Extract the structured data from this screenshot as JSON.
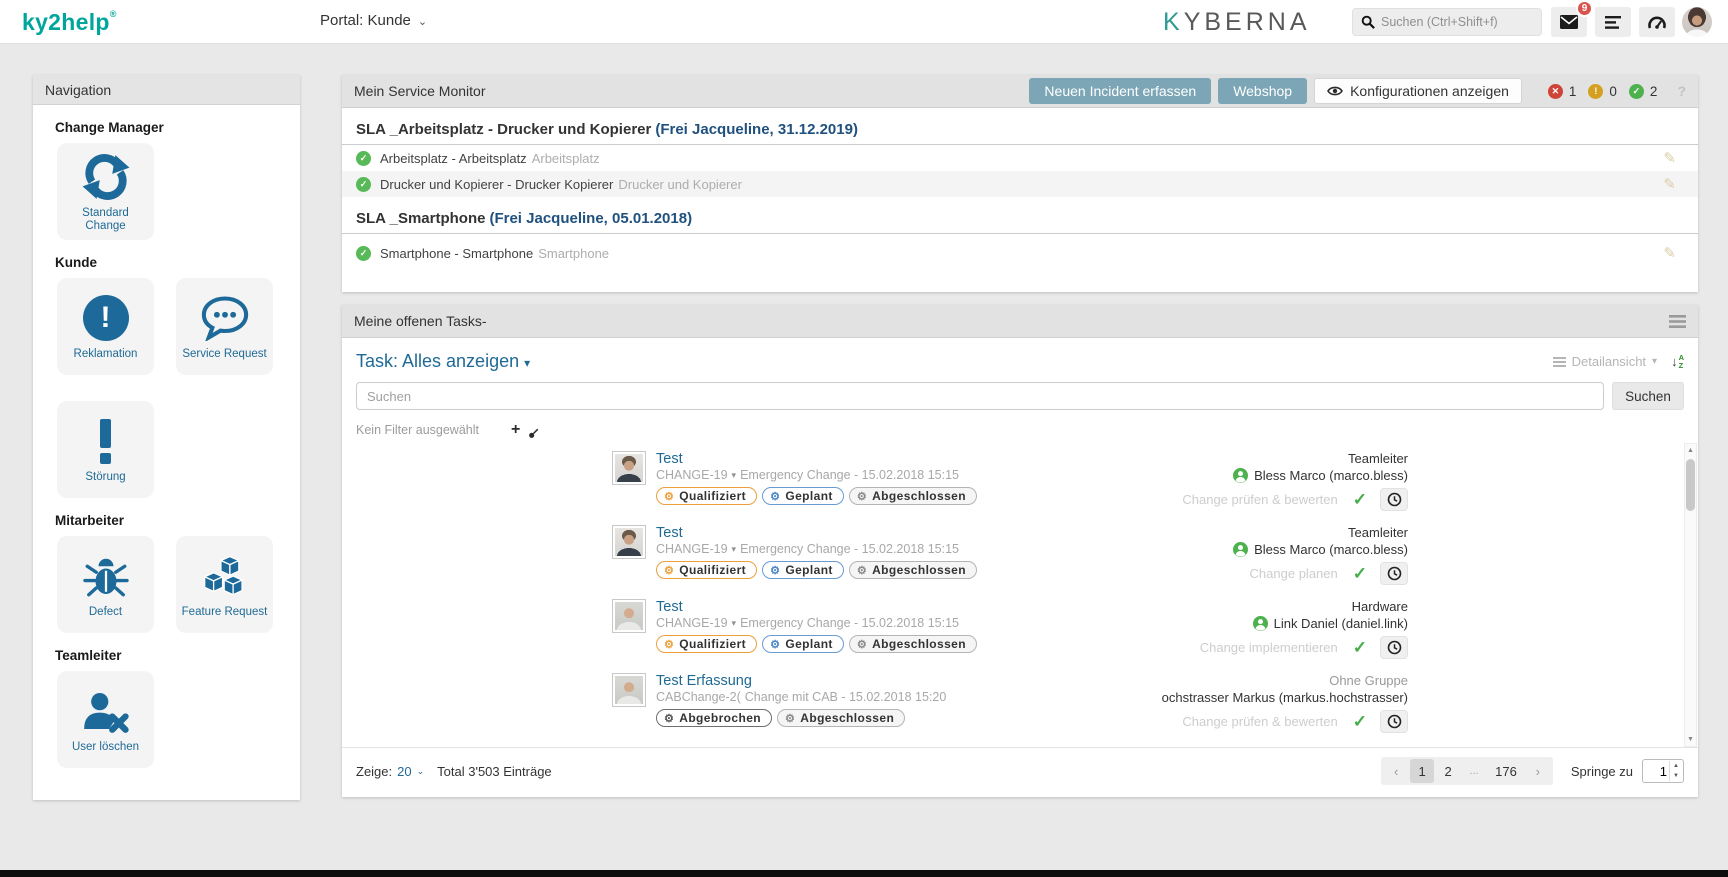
{
  "colors": {
    "accent_teal": "#00a69c",
    "link_blue": "#1f6a95",
    "button_teal": "#7ca6b6",
    "error_red": "#cf4436",
    "warn_yellow": "#d5a021",
    "ok_green": "#4db14d"
  },
  "icons": {
    "reg": "®",
    "caret_down": "▾",
    "chevron_down": "⌄",
    "check": "✓",
    "cross": "✕",
    "bang": "!",
    "question": "?",
    "pencil": "✎",
    "plus": "+",
    "gear": "⚙",
    "prev": "‹",
    "next": "›",
    "ellipsis": "...",
    "up": "▲",
    "down": "▼",
    "sort_arrow": "↓",
    "sort_a": "A",
    "sort_z": "Z"
  },
  "topbar": {
    "logo_text": "ky2help",
    "portal_label": "Portal: Kunde",
    "brand_k": "K",
    "brand_rest": "YBERNA",
    "search_placeholder": "Suchen (Ctrl+Shift+f)",
    "mail_badge": "9"
  },
  "sidebar": {
    "title": "Navigation",
    "sections": [
      {
        "label": "Change Manager",
        "tiles": [
          {
            "label": "Standard Change"
          }
        ]
      },
      {
        "label": "Kunde",
        "tiles": [
          {
            "label": "Reklamation"
          },
          {
            "label": "Service Request"
          },
          {
            "label": "Störung"
          }
        ]
      },
      {
        "label": "Mitarbeiter",
        "tiles": [
          {
            "label": "Defect"
          },
          {
            "label": "Feature Request"
          }
        ]
      },
      {
        "label": "Teamleiter",
        "tiles": [
          {
            "label": "User löschen"
          }
        ]
      }
    ]
  },
  "monitor": {
    "title": "Mein Service Monitor",
    "btn_incident": "Neuen Incident erfassen",
    "btn_webshop": "Webshop",
    "btn_config": "Konfigurationen anzeigen",
    "counters": [
      {
        "value": "1"
      },
      {
        "value": "0"
      },
      {
        "value": "2"
      }
    ],
    "groups": [
      {
        "heading": "SLA _Arbeitsplatz - Drucker und Kopierer",
        "heading_suffix": "(Frei Jacqueline, 31.12.2019)",
        "rows": [
          {
            "title": "Arbeitsplatz - Arbeitsplatz",
            "subtitle": "Arbeitsplatz"
          },
          {
            "title": "Drucker und Kopierer - Drucker Kopierer",
            "subtitle": "Drucker und Kopierer"
          }
        ]
      },
      {
        "heading": "SLA _Smartphone",
        "heading_suffix": "(Frei Jacqueline, 05.01.2018)",
        "rows": [
          {
            "title": "Smartphone - Smartphone",
            "subtitle": "Smartphone"
          }
        ]
      }
    ]
  },
  "tasks": {
    "title": "Meine offenen Tasks-",
    "filter_label": "Task: Alles anzeigen",
    "view_label": "Detailansicht",
    "search_placeholder": "Suchen",
    "search_button": "Suchen",
    "no_filter": "Kein Filter ausgewählt",
    "rows": [
      {
        "title": "Test",
        "meta_id": "CHANGE-19",
        "meta_rest": "Emergency Change - 15.02.2018 15:15",
        "badges": [
          {
            "label": "Qualifiziert"
          },
          {
            "label": "Geplant"
          },
          {
            "label": "Abgeschlossen"
          }
        ],
        "group": "Teamleiter",
        "assignee": "Bless Marco (marco.bless)",
        "action": "Change prüfen & bewerten"
      },
      {
        "title": "Test",
        "meta_id": "CHANGE-19",
        "meta_rest": "Emergency Change - 15.02.2018 15:15",
        "badges": [
          {
            "label": "Qualifiziert"
          },
          {
            "label": "Geplant"
          },
          {
            "label": "Abgeschlossen"
          }
        ],
        "group": "Teamleiter",
        "assignee": "Bless Marco (marco.bless)",
        "action": "Change planen"
      },
      {
        "title": "Test",
        "meta_id": "CHANGE-19",
        "meta_rest": "Emergency Change - 15.02.2018 15:15",
        "badges": [
          {
            "label": "Qualifiziert"
          },
          {
            "label": "Geplant"
          },
          {
            "label": "Abgeschlossen"
          }
        ],
        "group": "Hardware",
        "assignee": "Link Daniel (daniel.link)",
        "action": "Change implementieren"
      },
      {
        "title": "Test Erfassung",
        "meta_id": "CABChange-2(",
        "meta_rest": "Change mit CAB - 15.02.2018 15:20",
        "badges": [
          {
            "label": "Abgebrochen"
          },
          {
            "label": "Abgeschlossen"
          }
        ],
        "group": "Ohne Gruppe",
        "assignee": "ochstrasser Markus (markus.hochstrasser)",
        "action": "Change prüfen & bewerten"
      }
    ],
    "footer": {
      "zeige_label": "Zeige:",
      "page_size": "20",
      "total": "Total 3'503 Einträge",
      "pages": [
        "‹",
        "1",
        "2",
        "...",
        "176",
        "›"
      ],
      "springe_label": "Springe zu",
      "jump_value": "1"
    }
  }
}
